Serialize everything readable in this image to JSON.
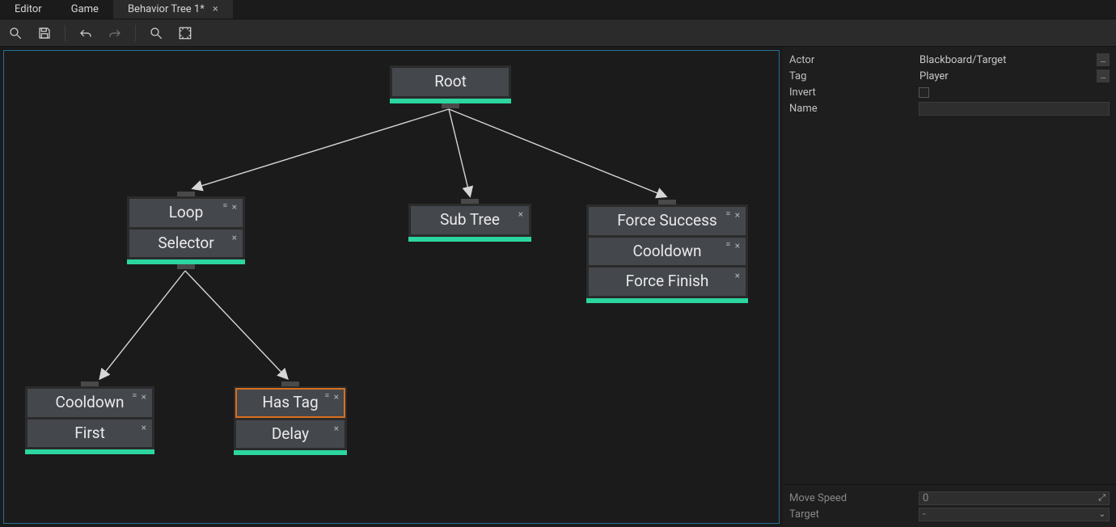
{
  "tabs": [
    {
      "label": "Editor",
      "active": false,
      "closable": false
    },
    {
      "label": "Game",
      "active": false,
      "closable": false
    },
    {
      "label": "Behavior Tree 1*",
      "active": true,
      "closable": true
    }
  ],
  "nodes": {
    "root": {
      "label": "Root"
    },
    "loop": {
      "label": "Loop"
    },
    "selector": {
      "label": "Selector"
    },
    "subtree": {
      "label": "Sub Tree"
    },
    "force_success": {
      "label": "Force Success"
    },
    "cooldown_t": {
      "label": "Cooldown"
    },
    "force_finish": {
      "label": "Force Finish"
    },
    "cooldown_l": {
      "label": "Cooldown"
    },
    "first": {
      "label": "First"
    },
    "has_tag": {
      "label": "Has Tag"
    },
    "delay": {
      "label": "Delay"
    }
  },
  "inspector": {
    "top": {
      "actor": {
        "label": "Actor",
        "value": "Blackboard/Target"
      },
      "tag": {
        "label": "Tag",
        "value": "Player"
      },
      "invert": {
        "label": "Invert",
        "checked": false
      },
      "name": {
        "label": "Name",
        "value": ""
      }
    },
    "bottom": {
      "move_speed": {
        "label": "Move Speed",
        "value": "0"
      },
      "target": {
        "label": "Target",
        "value": "-"
      }
    }
  }
}
